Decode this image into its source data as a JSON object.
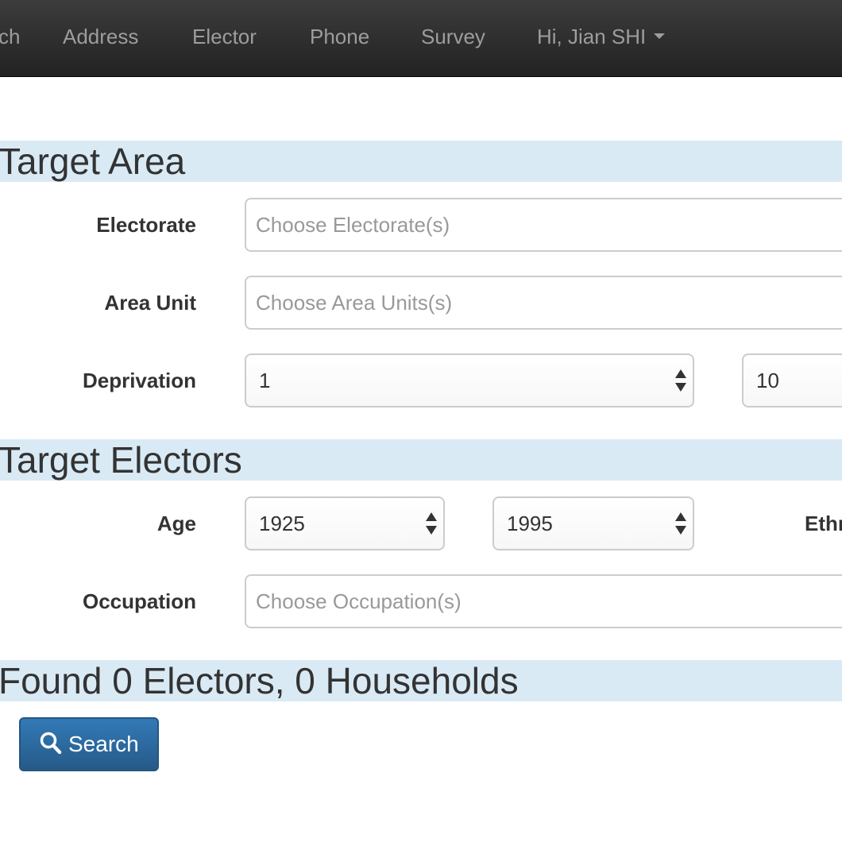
{
  "navbar": {
    "items": [
      {
        "label": "ch"
      },
      {
        "label": "Address"
      },
      {
        "label": "Elector"
      },
      {
        "label": "Phone"
      },
      {
        "label": "Survey"
      }
    ],
    "user_menu_label": "Hi, Jian SHI"
  },
  "target_area": {
    "heading": "Target Area",
    "electorate": {
      "label": "Electorate",
      "placeholder": "Choose Electorate(s)"
    },
    "area_unit": {
      "label": "Area Unit",
      "placeholder": "Choose Area Units(s)"
    },
    "deprivation": {
      "label": "Deprivation",
      "min_value": "1",
      "max_value": "10"
    }
  },
  "target_electors": {
    "heading": "Target Electors",
    "age": {
      "label": "Age",
      "from_value": "1925",
      "to_value": "1995"
    },
    "ethnicity_label": "Ethn",
    "occupation": {
      "label": "Occupation",
      "placeholder": "Choose Occupation(s)"
    }
  },
  "results": {
    "heading": "Found 0 Electors, 0 Households"
  },
  "search_button": {
    "label": "Search",
    "icon": "search-icon"
  }
}
